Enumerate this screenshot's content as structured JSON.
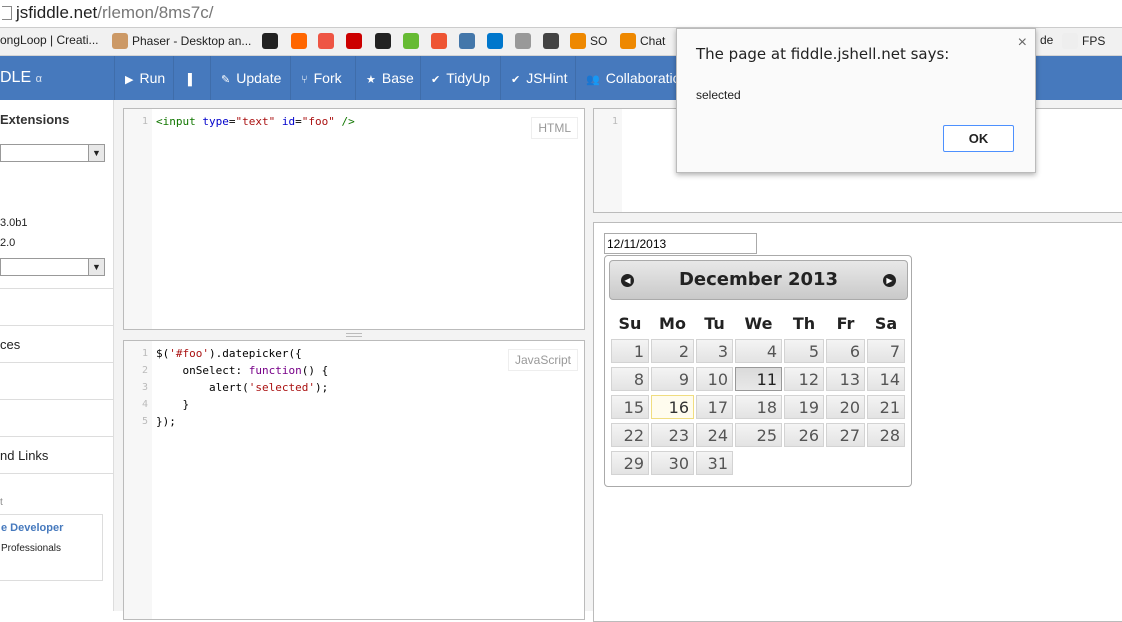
{
  "browser": {
    "url_host": "jsfiddle.net",
    "url_path": "/rlemon/8ms7c/"
  },
  "bookmarks": [
    {
      "label": "ongLoop | Creati...",
      "icon": "page-icon"
    },
    {
      "label": "Phaser - Desktop an...",
      "icon": "phaser-icon"
    },
    {
      "label": "",
      "icon": "github-icon"
    },
    {
      "label": "",
      "icon": "grooveshark-icon"
    },
    {
      "label": "",
      "icon": "play-icon"
    },
    {
      "label": "",
      "icon": "netflix-icon"
    },
    {
      "label": "",
      "icon": "steam-icon"
    },
    {
      "label": "",
      "icon": "plane-icon"
    },
    {
      "label": "",
      "icon": "ask-icon"
    },
    {
      "label": "",
      "icon": "stack-icon"
    },
    {
      "label": "",
      "icon": "trello-icon"
    },
    {
      "label": "",
      "icon": "reddit-icon"
    },
    {
      "label": "",
      "icon": "codepen-icon"
    },
    {
      "label": "SO",
      "icon": "stackoverflow-icon"
    },
    {
      "label": "Chat",
      "icon": "stackoverflow-icon"
    },
    {
      "label": "de",
      "icon": ""
    },
    {
      "label": "FPS",
      "icon": "page-icon"
    }
  ],
  "toolbar": {
    "logo": "DLE",
    "logo_suffix": "α",
    "buttons": [
      {
        "label": "Run",
        "icon": "▶"
      },
      {
        "label": "",
        "icon": "▐"
      },
      {
        "label": "Update",
        "icon": "✎"
      },
      {
        "label": "Fork",
        "icon": "⑂"
      },
      {
        "label": "Base",
        "icon": "★"
      },
      {
        "label": "TidyUp",
        "icon": "✔"
      },
      {
        "label": "JSHint",
        "icon": "✔"
      },
      {
        "label": "Collaboration",
        "icon": "👥"
      }
    ]
  },
  "sidebar": {
    "heading": "Extensions",
    "lib1": "3.0b1",
    "lib2": "2.0",
    "items": [
      "ces",
      "nd Links"
    ],
    "ad_small": "t",
    "ad_title": "e Developer",
    "ad_text": "Professionals"
  },
  "html_panel": {
    "label": "HTML",
    "lines": [
      "1"
    ]
  },
  "js_panel": {
    "label": "JavaScript",
    "lines": [
      "1",
      "2",
      "3",
      "4",
      "5"
    ]
  },
  "css_panel": {
    "lines": [
      "1"
    ]
  },
  "datepicker": {
    "input_value": "12/11/2013",
    "title": "December 2013",
    "prev": "◀",
    "next": "▶",
    "weekdays": [
      "Su",
      "Mo",
      "Tu",
      "We",
      "Th",
      "Fr",
      "Sa"
    ],
    "weeks": [
      [
        "1",
        "2",
        "3",
        "4",
        "5",
        "6",
        "7"
      ],
      [
        "8",
        "9",
        "10",
        "11",
        "12",
        "13",
        "14"
      ],
      [
        "15",
        "16",
        "17",
        "18",
        "19",
        "20",
        "21"
      ],
      [
        "22",
        "23",
        "24",
        "25",
        "26",
        "27",
        "28"
      ],
      [
        "29",
        "30",
        "31",
        "",
        "",
        "",
        ""
      ]
    ],
    "selected": "11",
    "today": "16"
  },
  "dialog": {
    "title": "The page at fiddle.jshell.net says:",
    "message": "selected",
    "ok": "OK",
    "close": "×"
  }
}
